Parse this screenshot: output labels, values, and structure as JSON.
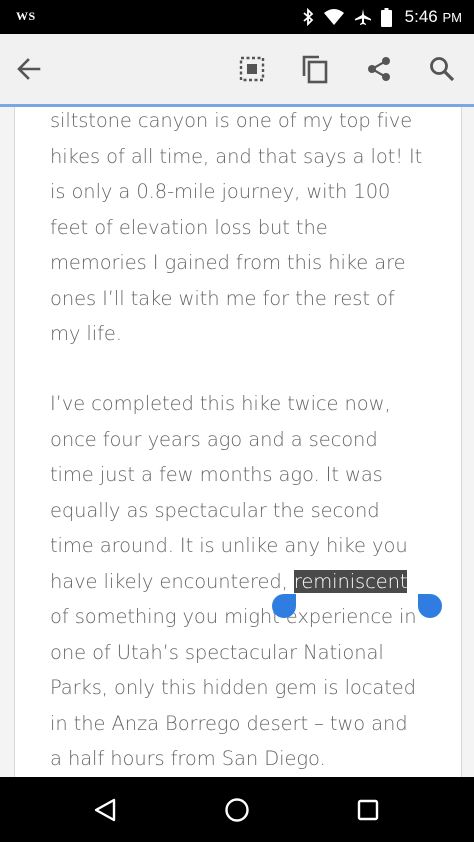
{
  "status_bar": {
    "carrier_badge": "WS",
    "time": "5:46",
    "ampm": "PM",
    "icons": [
      "bluetooth-icon",
      "wifi-icon",
      "airplane-icon",
      "battery-icon"
    ]
  },
  "toolbar": {
    "back_icon": "arrow-left-icon",
    "actions": [
      "select-all-icon",
      "copy-icon",
      "share-icon",
      "search-icon"
    ],
    "accent_color": "#7aa7e0"
  },
  "article": {
    "paragraph1_lines": [
      "siltstone canyon is one of my top five",
      "hikes of all time, and that says a lot! It",
      "is only a 0.8-mile journey, with 100",
      "feet of elevation loss but the",
      "memories I gained from this hike are",
      "ones I’ll take with me for the rest of",
      "my life."
    ],
    "paragraph2_lines": [
      "I’ve completed this hike twice now,",
      "once four years ago and a second",
      "time just a few months ago. It was",
      "equally as spectacular the second",
      "time around. It is unlike any hike you"
    ],
    "highlight_line_before": "have likely encountered, ",
    "selected_word": "reminiscent",
    "paragraph2_rest_lines": [
      "of something you might experience in",
      "one of Utah’s spectacular National",
      "Parks, only this hidden gem is located",
      "in the Anza Borrego desert – two and",
      "a half hours from San Diego."
    ],
    "selection_handle_color": "#2f7de1"
  },
  "nav_bar": {
    "buttons": [
      "back-triangle-icon",
      "home-circle-icon",
      "recents-square-icon"
    ]
  }
}
